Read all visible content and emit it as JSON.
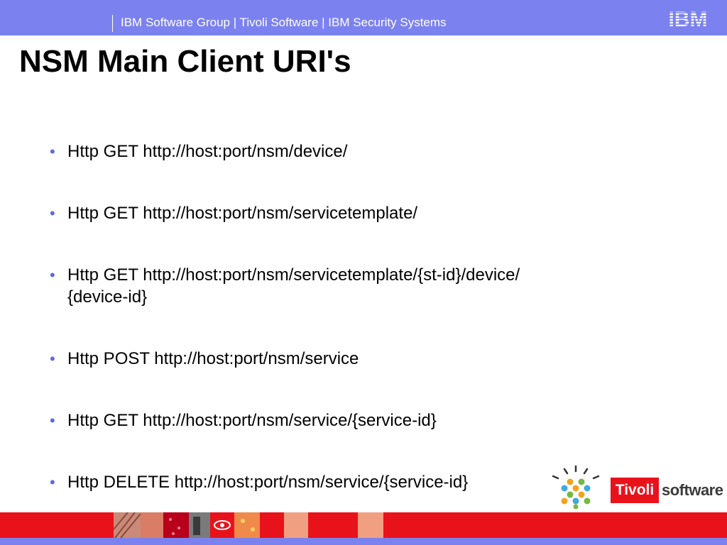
{
  "header": {
    "text": "IBM Software Group | Tivoli Software | IBM Security Systems",
    "logo_text": "IBM",
    "band_color": "#7b82ef"
  },
  "title": "NSM Main Client URI's",
  "bullets": [
    {
      "text": "Http GET http://host:port/nsm/device/"
    },
    {
      "text": "Http GET http://host:port/nsm/servicetemplate/"
    },
    {
      "text": "Http GET http://host:port/nsm/servicetemplate/{st-id}/device/{device-id}"
    },
    {
      "text": "Http POST http://host:port/nsm/service"
    },
    {
      "text": "Http GET http://host:port/nsm/service/{service-id}"
    },
    {
      "text": "Http DELETE http://host:port/nsm/service/{service-id}"
    }
  ],
  "footer": {
    "tivoli_label": "Tivoli",
    "software_label": "software",
    "accent_red": "#e8121b",
    "bullet_color": "#5b6ae6"
  }
}
